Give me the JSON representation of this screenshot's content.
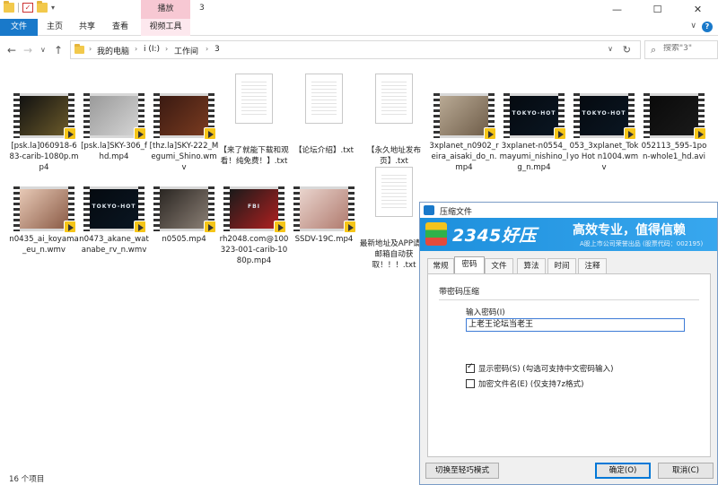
{
  "window": {
    "title": "3",
    "context_tab_group": "播放",
    "controls": {
      "minimize": "—",
      "maximize": "☐",
      "close": "✕"
    }
  },
  "ribbon": {
    "tabs": [
      "文件",
      "主页",
      "共享",
      "查看",
      "视频工具"
    ],
    "help": "?",
    "collapse": "∨"
  },
  "nav": {
    "back": "←",
    "forward": "→",
    "recent": "∨",
    "up": "↑",
    "breadcrumbs": [
      "我的电脑",
      "i (I:)",
      "工作间",
      "3"
    ],
    "separator": "›",
    "dropdown": "∨",
    "refresh": "↻",
    "search_placeholder": "搜索\"3\"",
    "search_icon": "⌕"
  },
  "files": [
    {
      "name": "[psk.la]060918-683-carib-1080p.mp4",
      "kind": "video",
      "colors": [
        "#111",
        "#6b5a2a"
      ]
    },
    {
      "name": "[psk.la]SKY-306_fhd.mp4",
      "kind": "video",
      "colors": [
        "#9a9a9a",
        "#d4d4d4"
      ]
    },
    {
      "name": "[thz.la]SKY-222_Megumi_Shino.wmv",
      "kind": "video",
      "colors": [
        "#3a1a12",
        "#7a3b20"
      ]
    },
    {
      "name": "【来了就能下载和观看！纯免费！】.txt",
      "kind": "text"
    },
    {
      "name": "【论坛介绍】.txt",
      "kind": "text"
    },
    {
      "name": "【永久地址发布页】.txt",
      "kind": "text"
    },
    {
      "name": "3xplanet_n0902_reira_aisaki_do_n.mp4",
      "kind": "video",
      "colors": [
        "#b9aa95",
        "#6f5d49"
      ]
    },
    {
      "name": "3xplanet-n0554_mayumi_nishino_lg_n.mp4",
      "kind": "video",
      "colors": [
        "#050a10",
        "#0a1622"
      ],
      "caption": "TOKYO-HOT"
    },
    {
      "name": "053_3xplanet_Tokyo Hot n1004.wmv",
      "kind": "video",
      "colors": [
        "#050a10",
        "#0a1622"
      ],
      "caption": "TOKYO-HOT"
    },
    {
      "name": "052113_595-1pon-whole1_hd.avi",
      "kind": "video",
      "colors": [
        "#0a0a0a",
        "#1a1a1a"
      ]
    },
    {
      "name": "n0435_ai_koyama_eu_n.wmv",
      "kind": "video",
      "colors": [
        "#e7c9b6",
        "#8a5a45"
      ]
    },
    {
      "name": "n0473_akane_watanabe_rv_n.wmv",
      "kind": "video",
      "colors": [
        "#050a10",
        "#0a1622"
      ],
      "caption": "TOKYO-HOT"
    },
    {
      "name": "n0505.mp4",
      "kind": "video",
      "colors": [
        "#2a2622",
        "#8b7f75"
      ]
    },
    {
      "name": "rh2048.com@100323-001-carib-1080p.mp4",
      "kind": "video",
      "colors": [
        "#1a1a1a",
        "#b02020"
      ],
      "caption": "FBI"
    },
    {
      "name": "SSDV-19C.mp4",
      "kind": "video",
      "colors": [
        "#e9d4cd",
        "#b07a6e"
      ]
    },
    {
      "name": "最新地址及APP请发邮箱自动获取！！！.txt",
      "kind": "text"
    }
  ],
  "status": {
    "item_count": "16 个项目"
  },
  "dialog": {
    "title": "压缩文件",
    "brand": "2345好压",
    "slogan": "高效专业，值得信赖",
    "sub": "A股上市公司荣誉出品 (股票代码：002195)",
    "tabs": [
      "常规",
      "密码",
      "文件",
      "算法",
      "时间",
      "注释"
    ],
    "active_tab": "密码",
    "group_title": "带密码压缩",
    "password_label": "输入密码(I)",
    "password_value": "上老王论坛当老王",
    "show_password": {
      "label": "显示密码(S)  (勾选可支持中文密码输入)",
      "checked": true
    },
    "encrypt_names": {
      "label": "加密文件名(E)  (仅支持7z格式)",
      "checked": false
    },
    "buttons": {
      "switch": "切换至轻巧模式",
      "ok": "确定(O)",
      "cancel": "取消(C)"
    }
  }
}
